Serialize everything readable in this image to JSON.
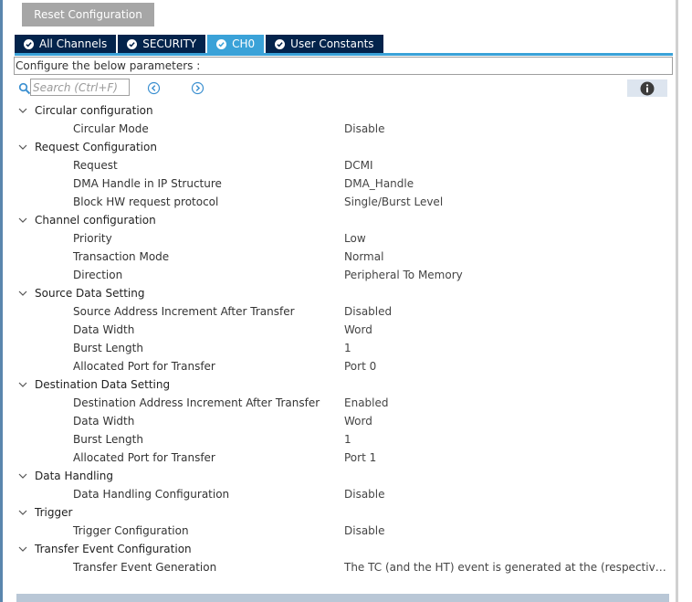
{
  "toolbar": {
    "reset_label": "Reset Configuration"
  },
  "tabs": [
    {
      "label": "All Channels",
      "active": false
    },
    {
      "label": "SECURITY",
      "active": false
    },
    {
      "label": "CH0",
      "active": true
    },
    {
      "label": "User Constants",
      "active": false
    }
  ],
  "params_label": "Configure the below parameters :",
  "search": {
    "placeholder": "Search (Ctrl+F)",
    "value": ""
  },
  "colors": {
    "tab_bg": "#03234b",
    "tab_active": "#3aa2d8",
    "button_bg": "#a6a6a6",
    "info_bg": "#dde5ef"
  },
  "groups": [
    {
      "label": "Circular configuration",
      "params": [
        {
          "label": "Circular Mode",
          "value": "Disable"
        }
      ]
    },
    {
      "label": "Request Configuration",
      "params": [
        {
          "label": "Request",
          "value": "DCMI"
        },
        {
          "label": "DMA Handle in IP Structure",
          "value": "DMA_Handle"
        },
        {
          "label": "Block HW request protocol",
          "value": "Single/Burst Level"
        }
      ]
    },
    {
      "label": "Channel configuration",
      "params": [
        {
          "label": "Priority",
          "value": "Low"
        },
        {
          "label": "Transaction Mode",
          "value": "Normal"
        },
        {
          "label": "Direction",
          "value": "Peripheral To Memory"
        }
      ]
    },
    {
      "label": "Source Data Setting",
      "params": [
        {
          "label": "Source Address Increment After Transfer",
          "value": "Disabled"
        },
        {
          "label": "Data Width",
          "value": "Word"
        },
        {
          "label": "Burst Length",
          "value": "1"
        },
        {
          "label": "Allocated Port for Transfer",
          "value": "Port 0"
        }
      ]
    },
    {
      "label": "Destination Data Setting",
      "params": [
        {
          "label": "Destination Address Increment After Transfer",
          "value": "Enabled"
        },
        {
          "label": "Data Width",
          "value": "Word"
        },
        {
          "label": "Burst Length",
          "value": "1"
        },
        {
          "label": "Allocated Port for Transfer",
          "value": "Port 1"
        }
      ]
    },
    {
      "label": "Data Handling",
      "params": [
        {
          "label": "Data Handling Configuration",
          "value": "Disable"
        }
      ]
    },
    {
      "label": "Trigger",
      "params": [
        {
          "label": "Trigger Configuration",
          "value": "Disable"
        }
      ]
    },
    {
      "label": "Transfer Event Configuration",
      "params": [
        {
          "label": "Transfer Event Generation",
          "value": "The TC (and the HT) event is generated at the (respectively half) end of each block"
        }
      ]
    }
  ]
}
